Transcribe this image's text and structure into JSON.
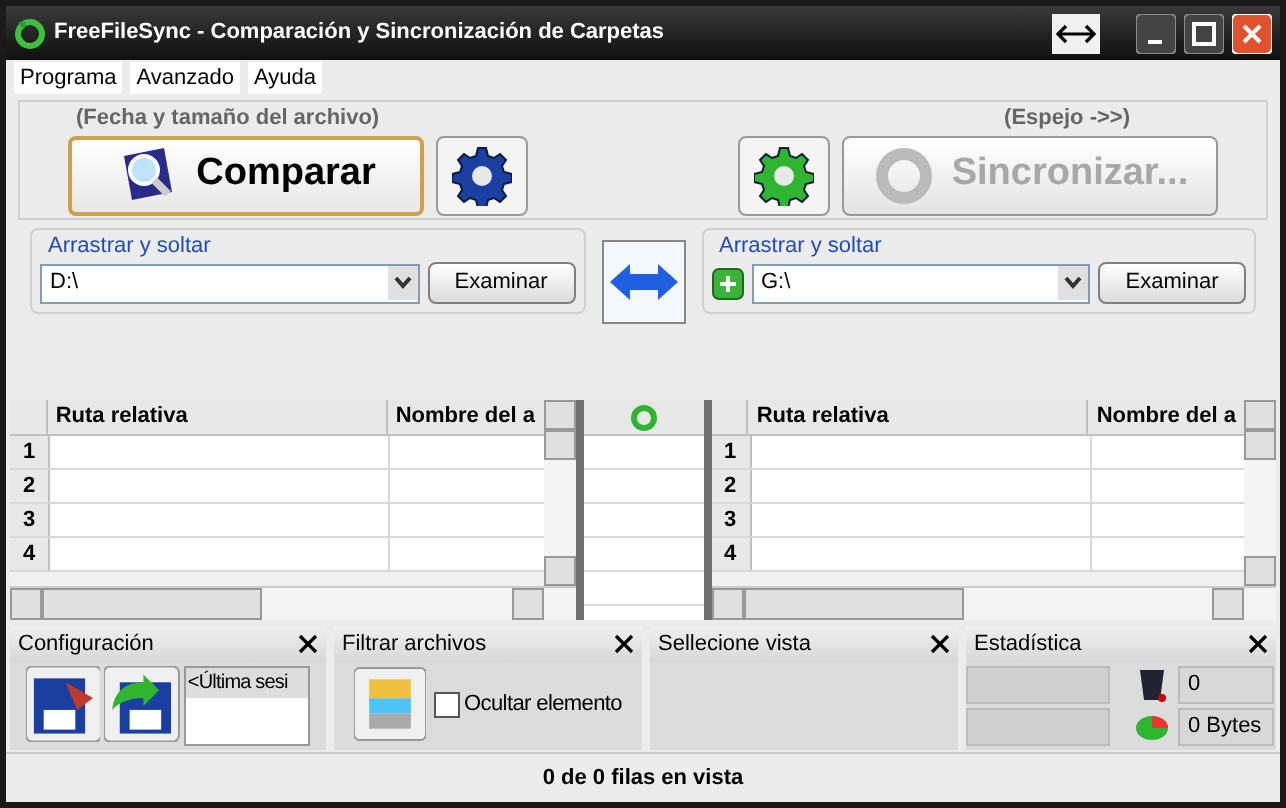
{
  "window": {
    "title": "FreeFileSync - Comparación y Sincronización de Carpetas"
  },
  "menu": [
    "Programa",
    "Avanzado",
    "Ayuda"
  ],
  "compare": {
    "caption": "(Fecha y tamaño del archivo)",
    "button": "Comparar"
  },
  "sync": {
    "caption": "(Espejo ->>)",
    "button": "Sincronizar...",
    "disabled": true
  },
  "left_folder": {
    "label": "Arrastrar y soltar",
    "value": "D:\\",
    "browse": "Examinar"
  },
  "right_folder": {
    "label": "Arrastrar y soltar",
    "value": "G:\\",
    "browse": "Examinar"
  },
  "left_grid": {
    "columns": [
      "Ruta relativa",
      "Nombre del a"
    ],
    "row_numbers": [
      "1",
      "2",
      "3",
      "4"
    ]
  },
  "right_grid": {
    "columns": [
      "Ruta relativa",
      "Nombre del a"
    ],
    "row_numbers": [
      "1",
      "2",
      "3",
      "4"
    ]
  },
  "config_panel": {
    "title": "Configuración",
    "items": [
      "<Última sesi"
    ]
  },
  "filter_panel": {
    "title": "Filtrar archivos",
    "checkbox": {
      "label": "Ocultar elemento",
      "checked": false
    }
  },
  "view_panel": {
    "title": "Sellecione vista"
  },
  "stats_panel": {
    "title": "Estadística",
    "values": [
      "0",
      "0 Bytes"
    ]
  },
  "status_bar": {
    "text": "0 de 0 filas en vista"
  }
}
